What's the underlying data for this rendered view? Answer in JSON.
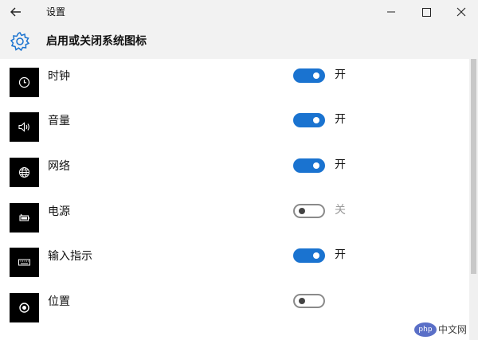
{
  "window": {
    "title": "设置"
  },
  "header": {
    "title": "启用或关闭系统图标"
  },
  "items": [
    {
      "label": "时钟",
      "icon": "clock-icon",
      "state": "开",
      "on": true
    },
    {
      "label": "音量",
      "icon": "volume-icon",
      "state": "开",
      "on": true
    },
    {
      "label": "网络",
      "icon": "network-globe-icon",
      "state": "开",
      "on": true
    },
    {
      "label": "电源",
      "icon": "battery-icon",
      "state": "关",
      "on": false
    },
    {
      "label": "输入指示",
      "icon": "keyboard-icon",
      "state": "开",
      "on": true
    },
    {
      "label": "位置",
      "icon": "location-icon",
      "state": "",
      "on": false
    }
  ],
  "watermark": {
    "logo": "php",
    "text": "中文网"
  },
  "colors": {
    "accent": "#1a73d0",
    "titlebar": "#f2f2f2",
    "tile": "#000000"
  }
}
